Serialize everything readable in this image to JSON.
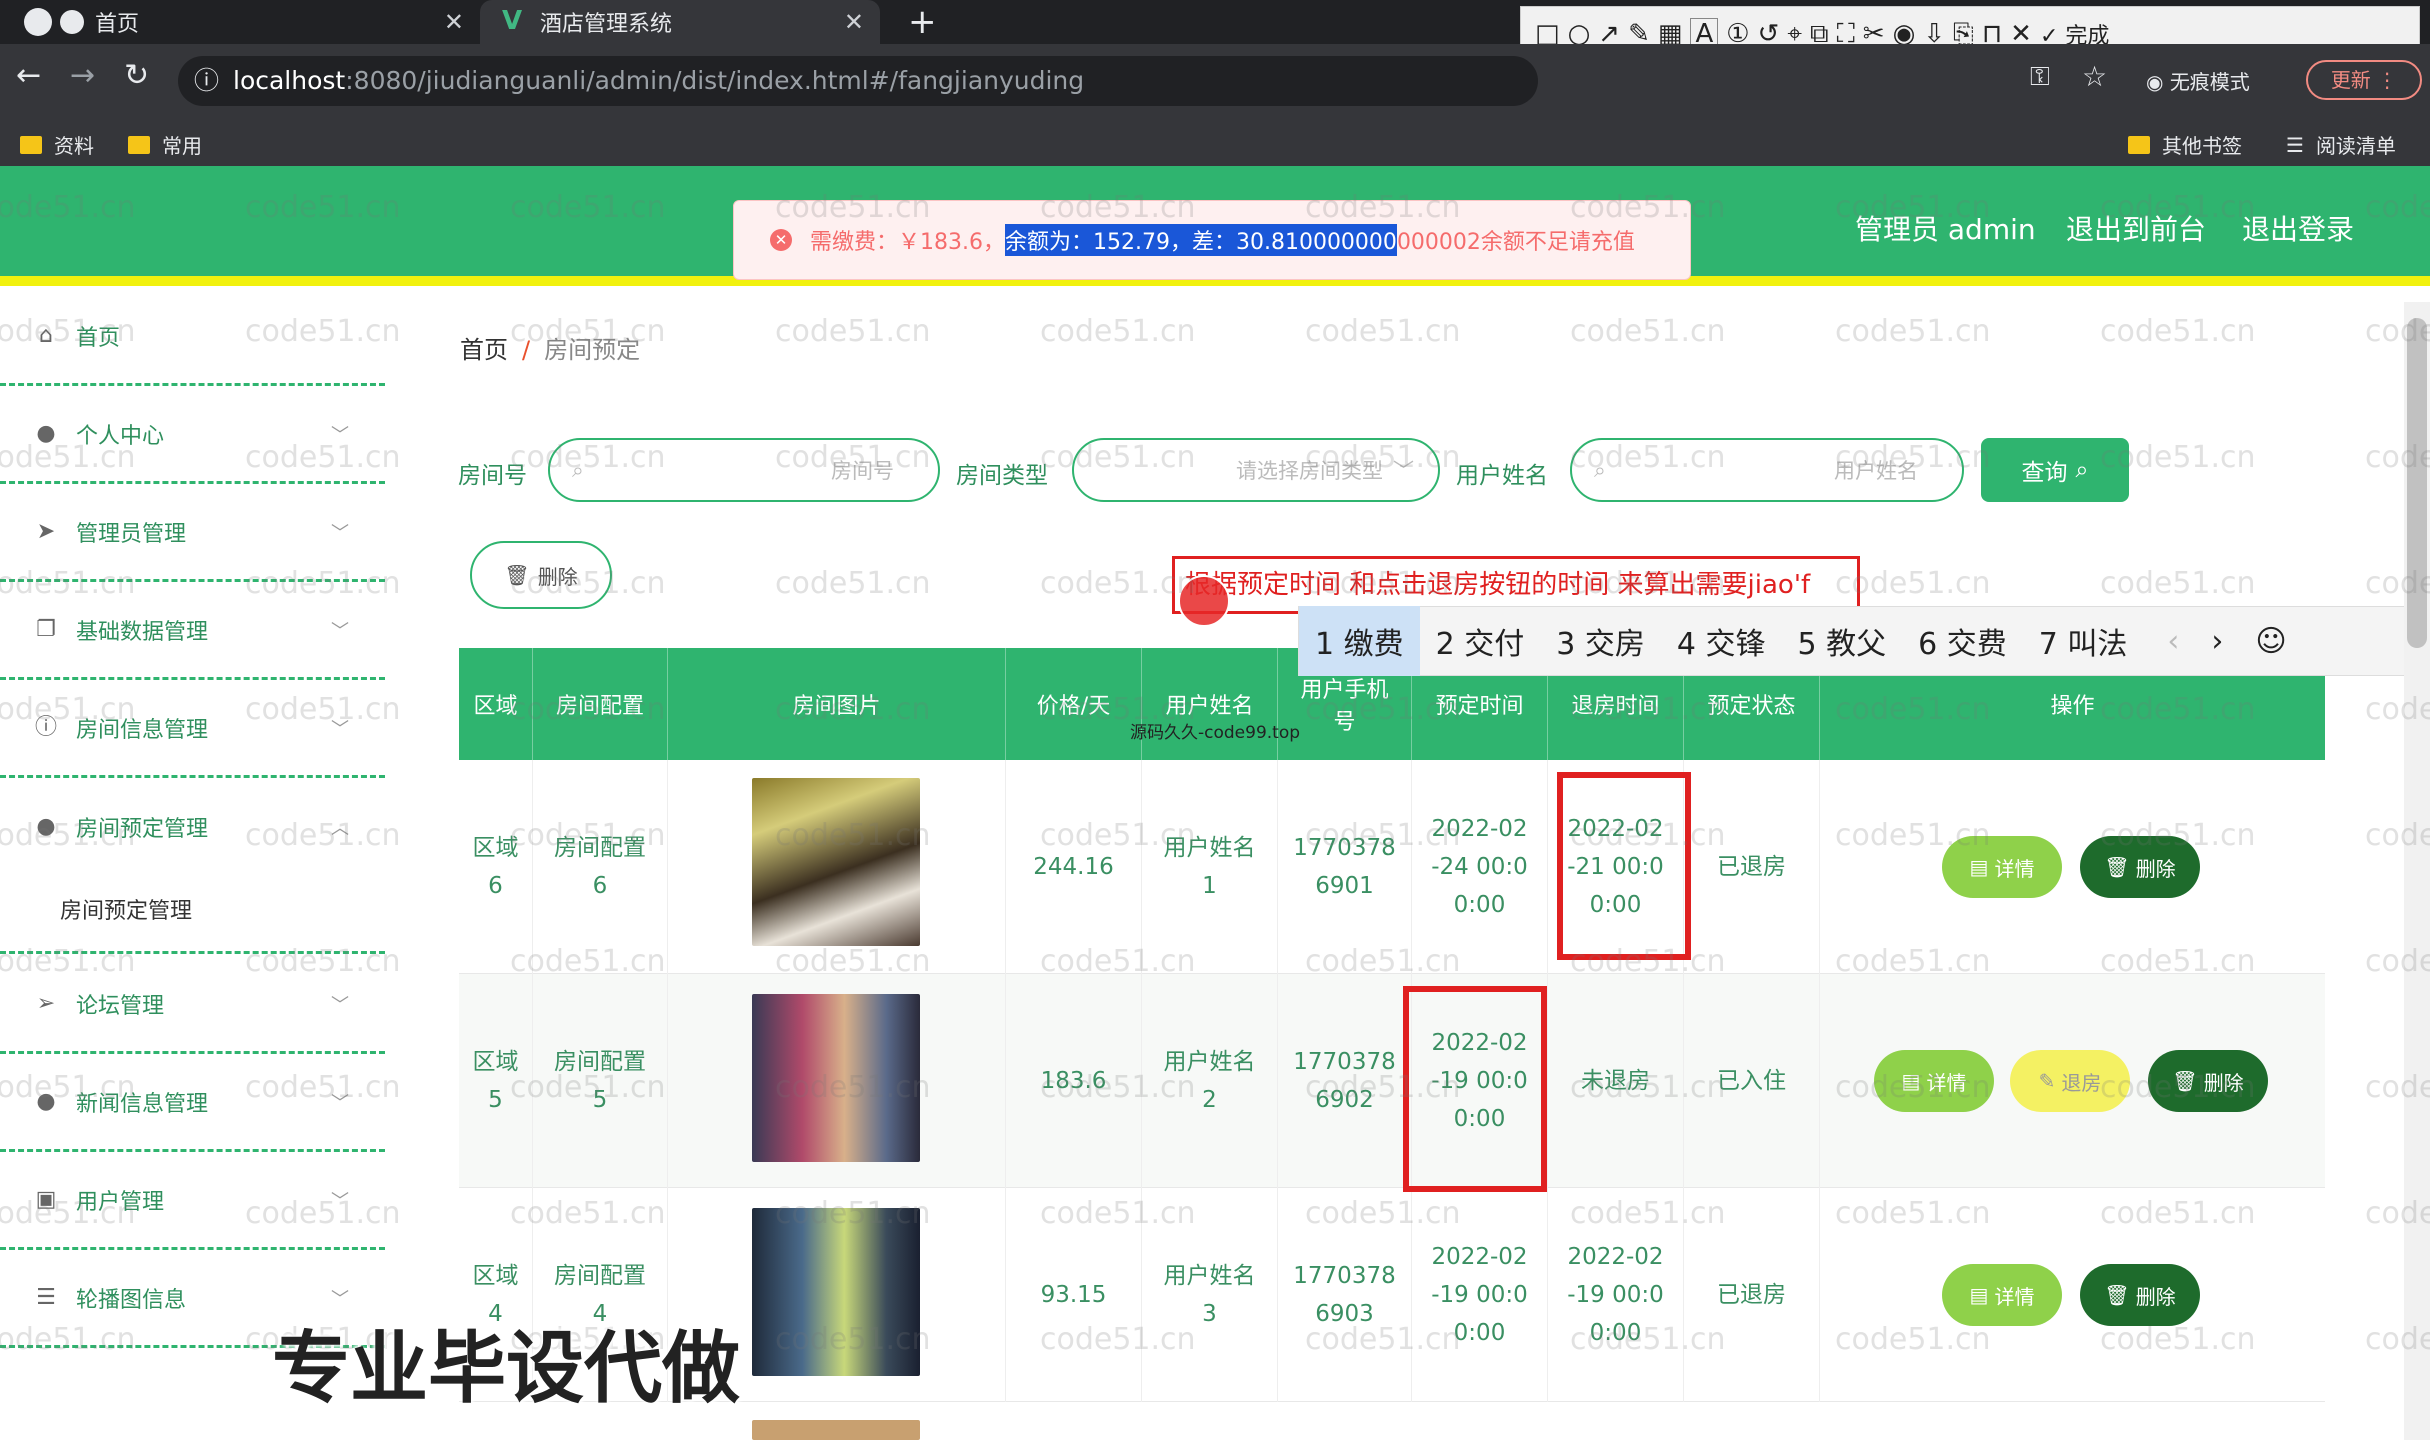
{
  "browser": {
    "tabs": [
      {
        "label": "首页"
      },
      {
        "label": "酒店管理系统"
      }
    ],
    "url_host": "localhost",
    "url_path": ":8080/jiudianguanli/admin/dist/index.html#/fangjianyuding",
    "bookmarks": [
      "资料",
      "常用"
    ],
    "bookmarks_right": [
      "其他书签",
      "阅读清单"
    ],
    "incognito": "无痕模式",
    "update": "更新",
    "finish": "完成",
    "font_size": "12"
  },
  "alert": {
    "pre": "需缴费：￥183.6，",
    "selected": "余额为：152.79，差：30.810000000",
    "post": "000002余额不足请充值"
  },
  "header_nav": [
    "管理员 admin",
    "退出到前台",
    "退出登录"
  ],
  "sidebar": [
    {
      "label": "首页"
    },
    {
      "label": "个人中心"
    },
    {
      "label": "管理员管理"
    },
    {
      "label": "基础数据管理"
    },
    {
      "label": "房间信息管理"
    },
    {
      "label": "房间预定管理"
    },
    {
      "label": "论坛管理"
    },
    {
      "label": "新闻信息管理"
    },
    {
      "label": "用户管理"
    },
    {
      "label": "轮播图信息"
    }
  ],
  "sidebar_sub": "房间预定管理",
  "breadcrumb": {
    "home": "首页",
    "sep": "/",
    "current": "房间预定"
  },
  "search": {
    "room_no_label": "房间号",
    "room_no_placeholder": "房间号",
    "room_type_label": "房间类型",
    "room_type_placeholder": "请选择房间类型",
    "user_label": "用户姓名",
    "user_placeholder": "用户姓名",
    "query": "查询"
  },
  "delete_btn": "删除",
  "annotation_text": "根据预定时间 和点击退房按钮的时间 来算出需要jiao'f",
  "ime_candidates": [
    "1 缴费",
    "2 交付",
    "3 交房",
    "4 交锋",
    "5 教父",
    "6 交费",
    "7 叫法"
  ],
  "overlay_small": "源码久久-code99.top",
  "table": {
    "headers": [
      "区域",
      "房间配置",
      "房间图片",
      "价格/天",
      "用户姓名",
      "用户手机号",
      "预定时间",
      "退房时间",
      "预定状态",
      "操作"
    ],
    "rows": [
      {
        "area": "区域\n6",
        "config": "房间配置\n6",
        "price": "244.16",
        "user": "用户姓名\n1",
        "phone": "1770378\n6901",
        "book": "2022-02\n-24 00:0\n0:00",
        "checkout": "2022-02\n-21 00:0\n0:00",
        "status": "已退房"
      },
      {
        "area": "区域\n5",
        "config": "房间配置\n5",
        "price": "183.6",
        "user": "用户姓名\n2",
        "phone": "1770378\n6902",
        "book": "2022-02\n-19 00:0\n0:00",
        "checkout": "未退房",
        "status": "已入住"
      },
      {
        "area": "区域\n4",
        "config": "房间配置\n4",
        "price": "93.15",
        "user": "用户姓名\n3",
        "phone": "1770378\n6903",
        "book": "2022-02\n-19 00:0\n0:00",
        "checkout": "2022-02\n-19 00:0\n0:00",
        "status": "已退房"
      }
    ],
    "btn_detail": "详情",
    "btn_delete": "删除",
    "btn_checkout": "退房"
  },
  "watermark": "code51.cn",
  "big_overlay": "专业毕设代做",
  "colors": {
    "primary": "#2fb46f",
    "header_border": "#f1f10e",
    "alert_text": "#f56c6c",
    "annotation_red": "#e02020"
  }
}
